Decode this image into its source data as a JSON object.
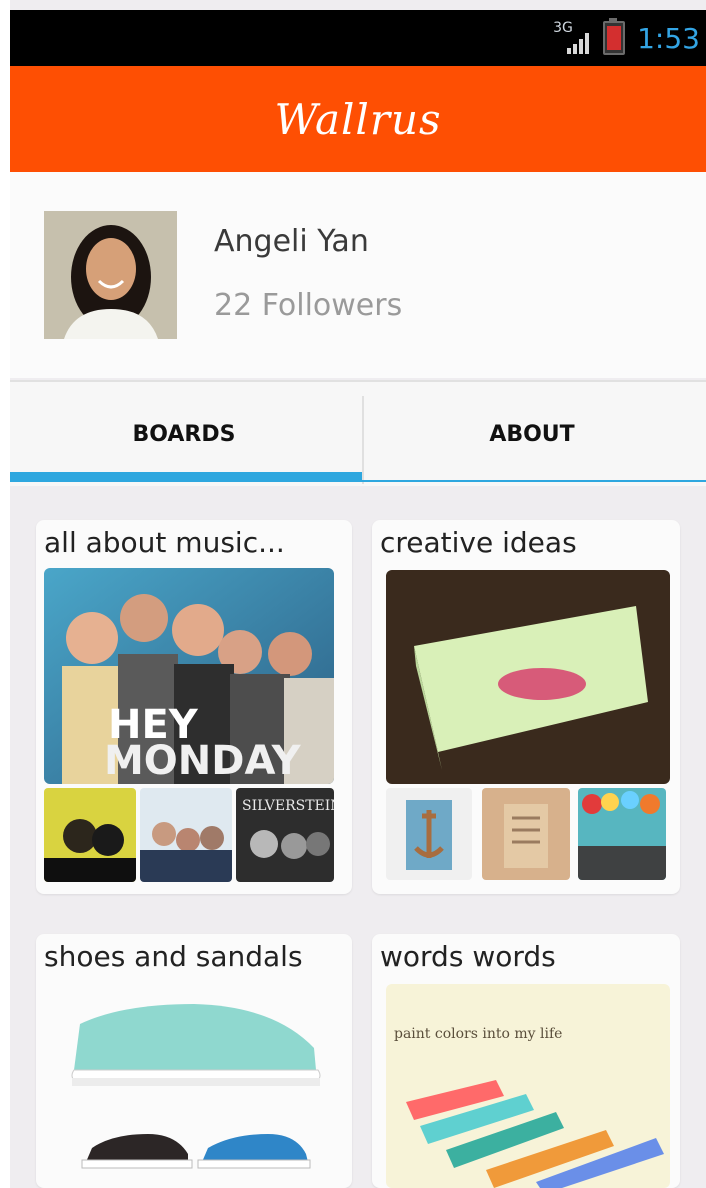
{
  "status": {
    "network": "3G",
    "time": "1:53"
  },
  "app": {
    "title": "Wallrus"
  },
  "profile": {
    "name": "Angeli Yan",
    "followers": "22 Followers"
  },
  "tabs": [
    {
      "label": "BOARDS",
      "selected": true
    },
    {
      "label": "ABOUT",
      "selected": false
    }
  ],
  "boards": [
    {
      "title": "all about music...",
      "poster_text": [
        "HEY",
        "MONDAY"
      ],
      "thumb_text": "SILVERSTEIN"
    },
    {
      "title": "creative ideas"
    },
    {
      "title": "shoes and sandals"
    },
    {
      "title": "words words",
      "image_text": "paint colors into my life"
    }
  ],
  "colors": {
    "app_bar": "#fe4f03",
    "accent": "#2ea7df",
    "status_time": "#33a5e5"
  }
}
